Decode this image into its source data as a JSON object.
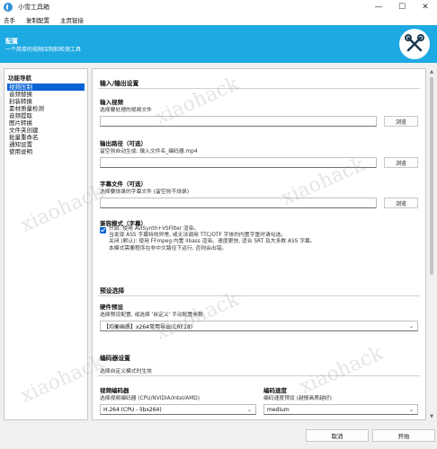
{
  "window": {
    "title": "小雪工具箱",
    "controls": [
      "—",
      "☐",
      "✕"
    ]
  },
  "menu": [
    "去手",
    "复制配置",
    "主页链接"
  ],
  "header": {
    "title": "配置",
    "subtitle": "一个简单的视频压制和检测工具",
    "icon": "tools-icon",
    "bg_color": "#1da9e1"
  },
  "sidebar": {
    "title": "功能导航",
    "items": [
      {
        "label": "视频压制",
        "active": true
      },
      {
        "label": "音频替换",
        "active": false
      },
      {
        "label": "封装转换",
        "active": false
      },
      {
        "label": "素材质量检测",
        "active": false
      },
      {
        "label": "音频提取",
        "active": false
      },
      {
        "label": "图片转换",
        "active": false
      },
      {
        "label": "文件夹创建",
        "active": false
      },
      {
        "label": "批量重命名",
        "active": false
      },
      {
        "label": "通知设置",
        "active": false
      },
      {
        "label": "使用说明",
        "active": false
      }
    ]
  },
  "main": {
    "io_section": "输入/输出设置",
    "input_video": {
      "label": "输入视频",
      "desc": "选择要处理的视频文件",
      "value": "",
      "button": "浏览"
    },
    "output_path": {
      "label": "输出路径（可选）",
      "desc": "留空则自动生成: 输入文件名_编码器.mp4",
      "value": "",
      "button": "浏览"
    },
    "subtitle_file": {
      "label": "字幕文件（可选）",
      "desc": "选择要烧录的字幕文件 (留空则不烧录)",
      "value": "",
      "button": "浏览"
    },
    "compat_mode": {
      "label": "兼容模式（字幕）",
      "checked": true,
      "lines": [
        "开启: 使用 AviSynth+VSFilter 渲染。",
        "当发现 ASS 字幕特效异常, 或无法调用 TTC/OTF 字体的内置字重时请勾选。",
        "关闭 (默认): 使用 FFmpeg 内置 libass 渲染。速度更快, 适合 SRT 及大多数 ASS 字幕。",
        "本模式需要程序在非中文路径下运行, 否则会出错。"
      ]
    },
    "preset_section": "预设选择",
    "preset": {
      "label": "硬件预设",
      "desc": "选择预设配置, 或选择 '自定义' 手动配置参数",
      "value": "【均衡画质】x264常用导出(CRF18)"
    },
    "encoder_section": "编码器设置",
    "encoder_note": "选择自定义模式时生效",
    "video_encoder": {
      "label": "视频编码器",
      "desc": "选择视频编码器 (CPU/NVIDIA/Intel/AMD)",
      "value": "H.264 (CPU - libx264)"
    },
    "encode_speed": {
      "label": "编码速度",
      "desc": "编码速度预设 (越慢画质越好)",
      "value": "medium"
    }
  },
  "footer": {
    "cancel": "取消",
    "start": "开始"
  },
  "watermark": "xiaohack"
}
